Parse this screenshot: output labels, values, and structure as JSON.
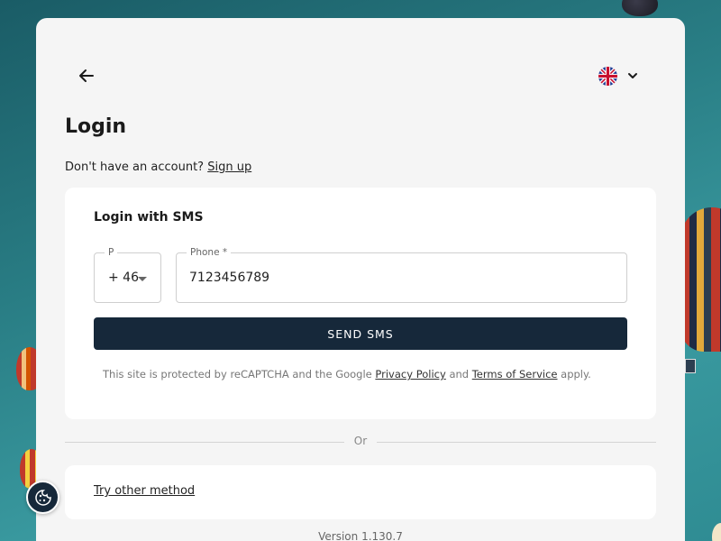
{
  "header": {
    "back_icon": "arrow-left-icon",
    "language_icon": "uk-flag-icon",
    "language_chevron": "chevron-down-icon"
  },
  "page": {
    "title": "Login",
    "no_account_text": "Don't have an account?",
    "signup_link": "Sign up"
  },
  "sms_form": {
    "title": "Login with SMS",
    "prefix_label": "P",
    "prefix_value": "+ 46",
    "phone_label": "Phone *",
    "phone_value": "7123456789",
    "send_button": "SEND SMS"
  },
  "recaptcha": {
    "text_before": "This site is protected by reCAPTCHA and the Google",
    "privacy_link": "Privacy Policy",
    "and_text": "and",
    "terms_link": "Terms of Service",
    "text_after": "apply."
  },
  "divider": {
    "label": "Or"
  },
  "other": {
    "link": "Try other method"
  },
  "footer": {
    "version": "Version 1.130.7"
  },
  "cookie": {
    "icon": "cookie-icon"
  },
  "colors": {
    "primary_button": "#16283a",
    "card_background": "#f5f5f5",
    "panel_background": "#ffffff"
  }
}
